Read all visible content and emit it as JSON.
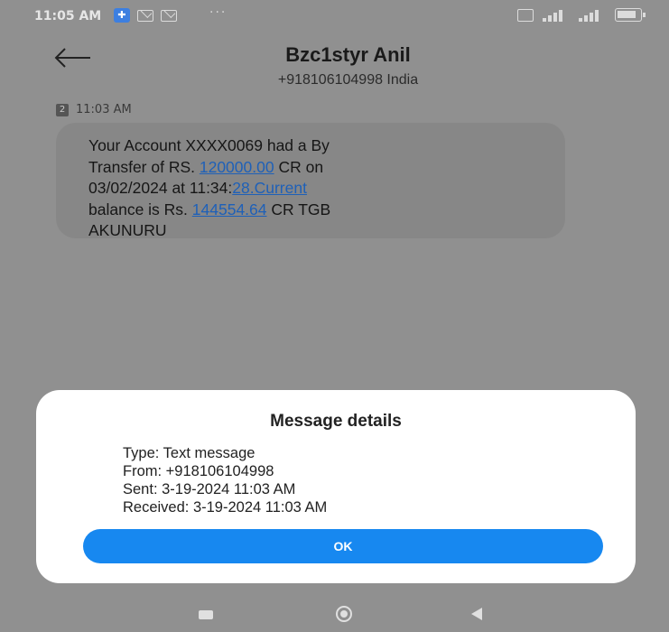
{
  "status_bar": {
    "time": "11:05 AM",
    "badge_icon": "app-notification-icon",
    "dots": "···"
  },
  "header": {
    "contact_name": "Bzc1styr Anil",
    "contact_number_country": "+918106104998 India"
  },
  "message": {
    "sim_slot": "2",
    "time": "11:03 AM",
    "line1": "Your Account XXXX0069 had a By",
    "line2_pre": "Transfer of RS. ",
    "line2_link": "120000.00",
    "line2_post": " CR on",
    "line3_pre": "03/02/2024 at 11:34:",
    "line3_link": "28.Current",
    "line4_pre": "balance is Rs. ",
    "line4_link": "144554.64",
    "line4_post": " CR TGB",
    "line5": "AKUNURU"
  },
  "dialog": {
    "title": "Message details",
    "type": "Type: Text message",
    "from": "From: +918106104998",
    "sent": "Sent: 3-19-2024 11:03 AM",
    "received": "Received: 3-19-2024 11:03 AM",
    "ok_label": "OK"
  },
  "colors": {
    "ok_button": "#1788f0",
    "link": "#1e60b8",
    "dialog_bg": "#ffffff",
    "dim_background": "#909090"
  }
}
